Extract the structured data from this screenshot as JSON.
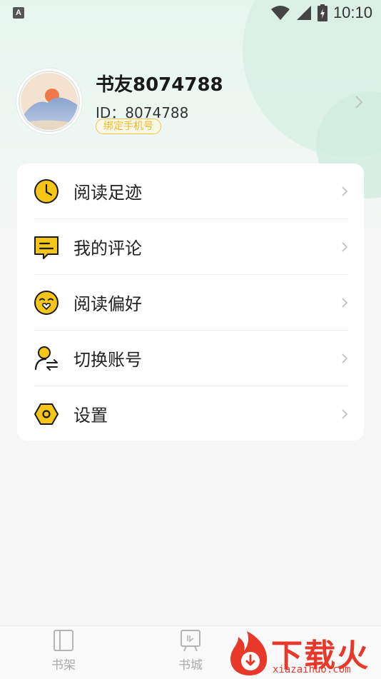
{
  "status_bar": {
    "notification_icon": "A",
    "time": "10:10"
  },
  "profile": {
    "username": "书友8074788",
    "id_text": "ID：8074788",
    "bind_phone_label": "绑定手机号"
  },
  "menu": {
    "items": [
      {
        "label": "阅读足迹",
        "icon": "clock-icon"
      },
      {
        "label": "我的评论",
        "icon": "comment-icon"
      },
      {
        "label": "阅读偏好",
        "icon": "smiley-icon"
      },
      {
        "label": "切换账号",
        "icon": "switch-account-icon"
      },
      {
        "label": "设置",
        "icon": "settings-icon"
      }
    ]
  },
  "bottom_nav": {
    "items": [
      {
        "label": "书架",
        "icon": "bookshelf-icon"
      },
      {
        "label": "书城",
        "icon": "bookstore-icon"
      }
    ]
  },
  "watermark": {
    "text": "下载火",
    "url": "xiazaihuo.com"
  },
  "colors": {
    "accent": "#f5c518",
    "icon_stroke": "#1a1a1a",
    "watermark": "#e8382a"
  }
}
